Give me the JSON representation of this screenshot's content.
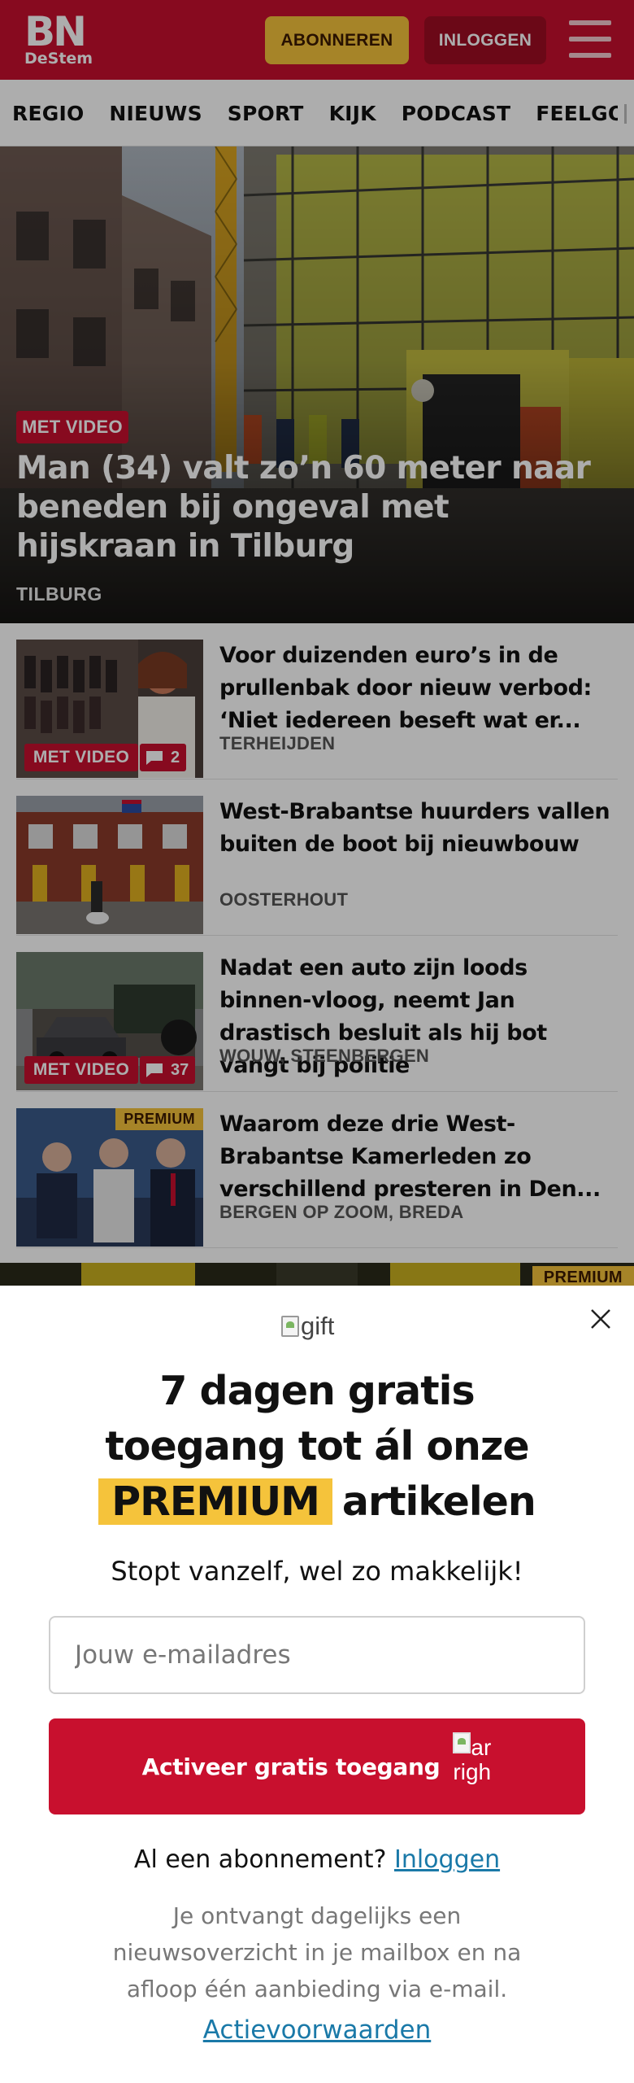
{
  "header": {
    "logo_main": "BN",
    "logo_sub": "DeStem",
    "subscribe_label": "ABONNEREN",
    "login_label": "INLOGGEN",
    "brand_color": "#c8102e",
    "accent_color": "#f5c33b",
    "menu_icon": "hamburger-icon"
  },
  "nav": {
    "items": [
      "REGIO",
      "NIEUWS",
      "SPORT",
      "KIJK",
      "PODCAST",
      "FEELGOOD"
    ]
  },
  "hero": {
    "badge": "MET VIDEO",
    "title": "Man (34) valt zo’n 60 meter naar beneden bij ongeval met hijskraan in Tilburg",
    "location": "TILBURG"
  },
  "articles": [
    {
      "title": "Voor duizenden euro’s in de prullenbak door nieuw verbod: ‘Niet iedereen beseft wat er...",
      "location": "TERHEIJDEN",
      "badge": "MET VIDEO",
      "comments": "2"
    },
    {
      "title": "West-Brabantse huurders vallen buiten de boot bij nieuwbouw",
      "location": "OOSTERHOUT"
    },
    {
      "title": "Nadat een auto zijn loods binnen-vloog, neemt Jan drastisch besluit als hij bot vangt bij politie",
      "location": "WOUW, STEENBERGEN",
      "badge": "MET VIDEO",
      "comments": "37"
    },
    {
      "title": "Waarom deze drie West-Brabantse Kamerleden zo verschillend presteren in Den...",
      "location": "BERGEN OP ZOOM, BREDA",
      "premium": "PREMIUM"
    }
  ],
  "peek": {
    "premium": "PREMIUM"
  },
  "modal": {
    "gift_alt": "gift",
    "headline_line1": "7 dagen gratis",
    "headline_line2": "toegang tot ál onze",
    "headline_highlight": "PREMIUM",
    "headline_line3_rest": "artikelen",
    "subline": "Stopt vanzelf, wel zo makkelijk!",
    "email_placeholder": "Jouw e-mailadres",
    "cta_label": "Activeer gratis toegang",
    "cta_icon_alt_1": "arro",
    "cta_icon_alt_2": "righ",
    "already_text": "Al een abonnement?",
    "login_link": "Inloggen",
    "disclaimer": "Je ontvangt dagelijks een nieuwsoverzicht in je mailbox en na afloop één aanbieding via e-mail.",
    "terms_link": "Actievoorwaarden"
  }
}
